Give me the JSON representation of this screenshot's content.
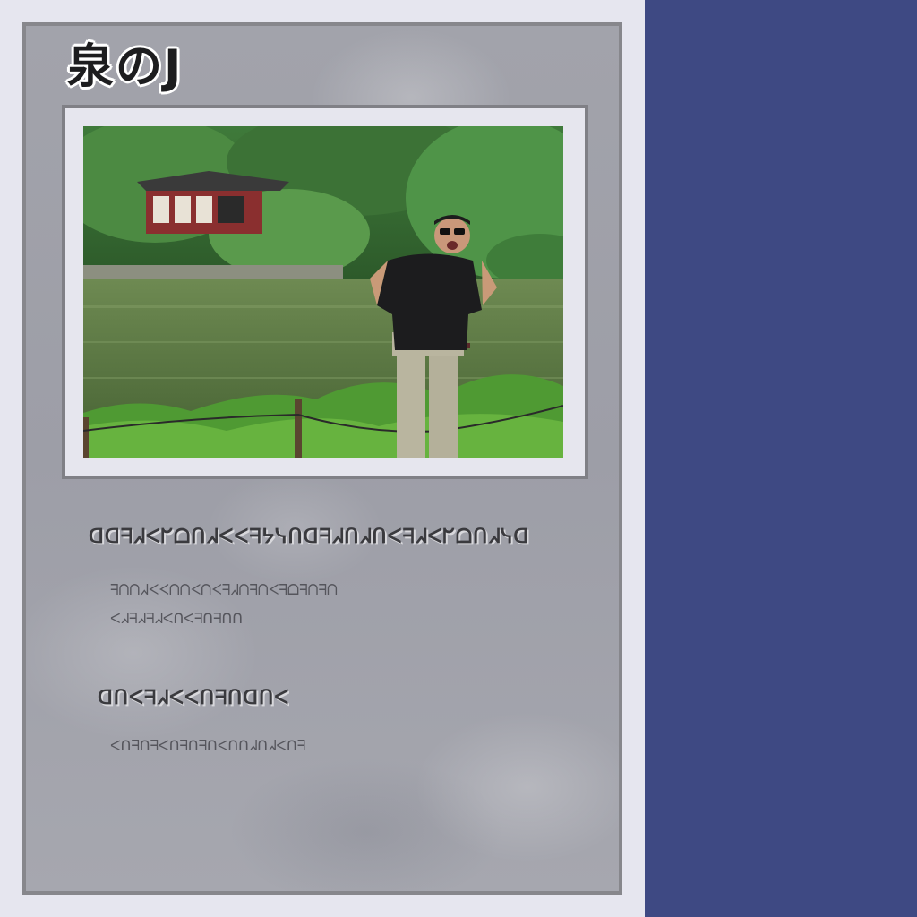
{
  "card": {
    "title": "泉のJ"
  },
  "description": {
    "heading_1": "ᗡᗡᖷᖽᐸᖸᗝᑎᖽᐸᐸᖷᔭᓭᑎᗡᖷᖽᑎᖽᑎᐸᖷᖽᐸᖸᗝᑎᖽᓭᗡ",
    "line_1": "ᖷᑎᑎᖽᐸᐸᑎᑎᐸᑎᐸᖷᖽᑎᖷᑎᐸᖷᗝᖷᑎᖷᑎ",
    "line_2": "ᐸᖽᖷᖽᖷᖽᐸᑎᐸᖷᑎᖷᑎᑎ",
    "heading_2": "ᗡᑎᐸᖷᖽᐸᐸᑎᖷᑎᗡᑎᐸ",
    "line_3": "ᐸᑎᖷᑎᖷᐸᑎᖷᑎᖷᑎᐸᑎᑎᖽᑎᖽᐸᑎᖷ"
  },
  "colors": {
    "side_panel": "#3e4983",
    "card_border": "#87878c"
  }
}
